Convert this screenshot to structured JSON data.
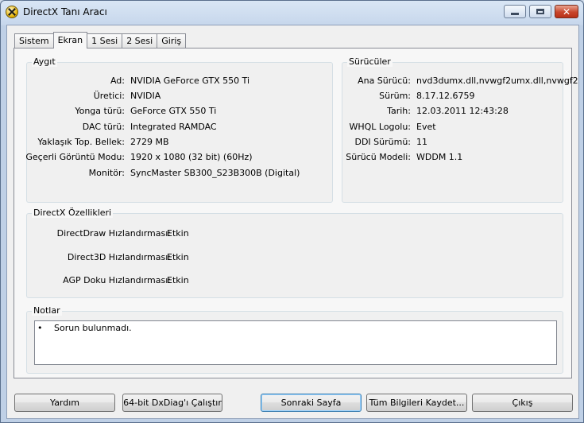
{
  "window": {
    "title": "DirectX Tanı Aracı"
  },
  "tabs": [
    {
      "label": "Sistem",
      "active": false
    },
    {
      "label": "Ekran",
      "active": true
    },
    {
      "label": "1 Sesi",
      "active": false
    },
    {
      "label": "2 Sesi",
      "active": false
    },
    {
      "label": "Giriş",
      "active": false
    }
  ],
  "device": {
    "title": "Aygıt",
    "rows": [
      {
        "label": "Ad:",
        "value": "NVIDIA GeForce GTX 550 Ti"
      },
      {
        "label": "Üretici:",
        "value": "NVIDIA"
      },
      {
        "label": "Yonga türü:",
        "value": "GeForce GTX 550 Ti"
      },
      {
        "label": "DAC türü:",
        "value": "Integrated RAMDAC"
      },
      {
        "label": "Yaklaşık Top. Bellek:",
        "value": "2729 MB"
      },
      {
        "label": "Geçerli Görüntü Modu:",
        "value": "1920 x 1080 (32 bit) (60Hz)"
      },
      {
        "label": "Monitör:",
        "value": "SyncMaster SB300_S23B300B (Digital)"
      }
    ]
  },
  "drivers": {
    "title": "Sürücüler",
    "rows": [
      {
        "label": "Ana Sürücü:",
        "value": "nvd3dumx.dll,nvwgf2umx.dll,nvwgf2"
      },
      {
        "label": "Sürüm:",
        "value": "8.17.12.6759"
      },
      {
        "label": "Tarih:",
        "value": "12.03.2011 12:43:28"
      },
      {
        "label": "WHQL Logolu:",
        "value": "Evet"
      },
      {
        "label": "DDI Sürümü:",
        "value": "11"
      },
      {
        "label": "Sürücü Modeli:",
        "value": "WDDM 1.1"
      }
    ]
  },
  "features": {
    "title": "DirectX Özellikleri",
    "rows": [
      {
        "label": "DirectDraw Hızlandırması:",
        "value": "Etkin"
      },
      {
        "label": "Direct3D Hızlandırması:",
        "value": "Etkin"
      },
      {
        "label": "AGP Doku Hızlandırması:",
        "value": "Etkin"
      }
    ]
  },
  "notes": {
    "title": "Notlar",
    "bullet": "•",
    "items": [
      "Sorun bulunmadı."
    ]
  },
  "buttons": {
    "help": "Yardım",
    "run64": "64-bit DxDiag'ı Çalıştır",
    "next": "Sonraki Sayfa",
    "save": "Tüm Bilgileri Kaydet...",
    "exit": "Çıkış"
  },
  "caption": {
    "close_glyph": "✕"
  }
}
